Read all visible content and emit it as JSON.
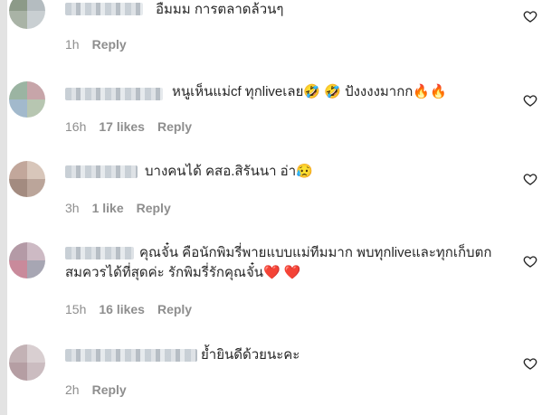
{
  "comments": [
    {
      "text": "อืมมม การตลาดล้วนๆ",
      "time": "1h",
      "likes": "",
      "reply": "Reply"
    },
    {
      "text": "หนูเห็นแม่cf ทุกliveเลย🤣 🤣 ปังงงงมากก🔥🔥",
      "time": "16h",
      "likes": "17 likes",
      "reply": "Reply"
    },
    {
      "text": "บางคนได้ คสอ.สิรันนา อ่า😥",
      "time": "3h",
      "likes": "1 like",
      "reply": "Reply"
    },
    {
      "text": "คุณจั๋น คือนักพิมรี่พายแบบแม่ทีมมาก พบทุกliveและทุกเก็บตก สมควรได้ที่สุดค่ะ รักพิมรี่รักคุณจั๋น❤️ ❤️",
      "time": "15h",
      "likes": "16 likes",
      "reply": "Reply"
    },
    {
      "text": "ย้ำยินดีด้วยนะคะ",
      "time": "2h",
      "likes": "",
      "reply": "Reply"
    }
  ],
  "icons": {
    "like": "heart-outline-icon"
  },
  "colors": {
    "text": "#262626",
    "meta": "#8e8e8e",
    "background": "#ffffff"
  }
}
